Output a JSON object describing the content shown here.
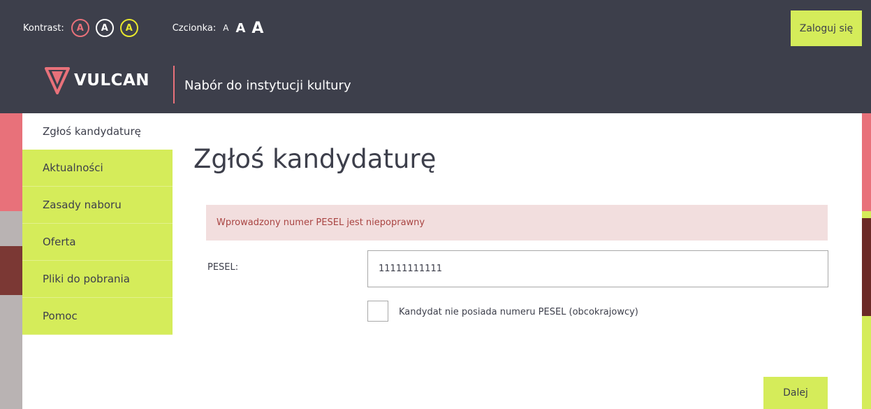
{
  "colors": {
    "header_bg": "#3d3f4b",
    "accent_green": "#d5ec5a",
    "accent_red": "#e8717a",
    "contrast_yellow": "#e8e72d",
    "alert_bg": "#f2dede",
    "alert_text": "#a94442"
  },
  "header": {
    "contrast_label": "Kontrast:",
    "contrast_options": [
      "A",
      "A",
      "A"
    ],
    "font_label": "Czcionka:",
    "font_sizes": [
      "A",
      "A",
      "A"
    ],
    "login_label": "Zaloguj się",
    "brand": "VULCAN",
    "app_title": "Nabór do instytucji kultury"
  },
  "sidebar": {
    "active": "Zgłoś kandydaturę",
    "items": [
      {
        "label": "Aktualności"
      },
      {
        "label": "Zasady naboru"
      },
      {
        "label": "Oferta"
      },
      {
        "label": "Pliki do pobrania"
      },
      {
        "label": "Pomoc"
      }
    ]
  },
  "main": {
    "title": "Zgłoś kandydaturę",
    "alert": "Wprowadzony numer PESEL jest niepoprawny",
    "pesel_label": "PESEL:",
    "pesel_value": "11111111111",
    "no_pesel_label": "Kandydat nie posiada numeru PESEL (obcokrajowcy)",
    "next_label": "Dalej"
  }
}
